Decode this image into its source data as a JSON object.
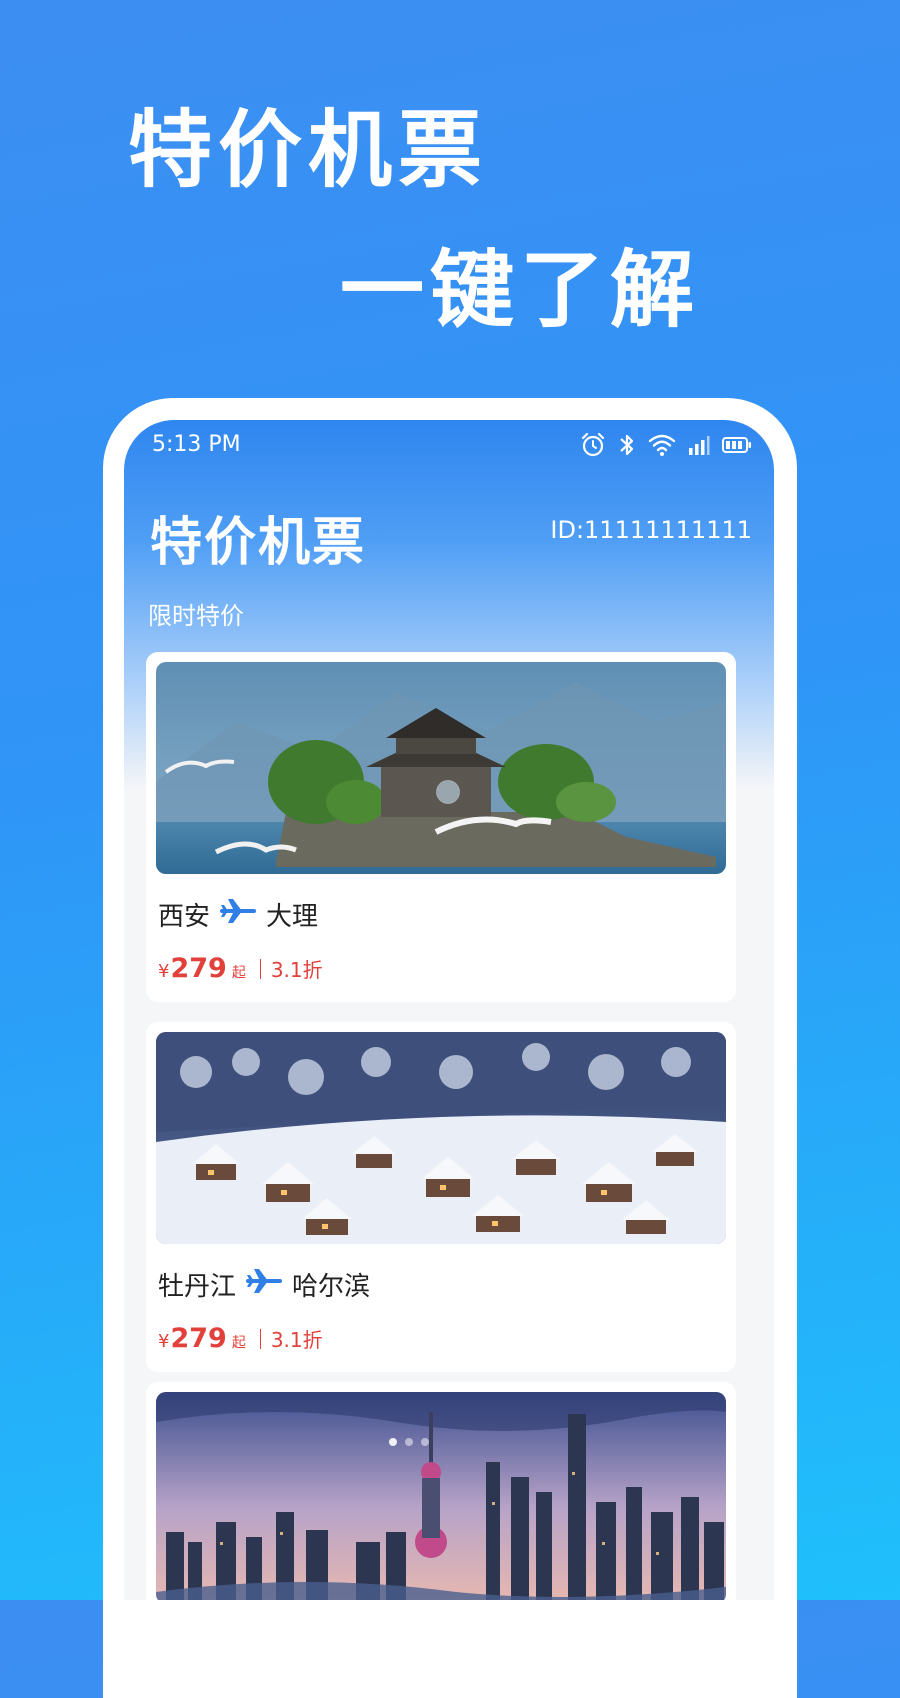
{
  "promo": {
    "line1": "特价机票",
    "line2": "一键了解"
  },
  "status_bar": {
    "time": "5:13 PM",
    "icons": [
      "alarm-icon",
      "bluetooth-icon",
      "wifi-icon",
      "signal-icon",
      "battery-icon"
    ]
  },
  "header": {
    "title": "特价机票",
    "user_id": "ID:11111111111",
    "section_label": "限时特价"
  },
  "deals": [
    {
      "from": "西安",
      "to": "大理",
      "currency": "¥",
      "price": "279",
      "price_suffix": "起",
      "discount": "3.1折",
      "image": "lake-pavilion-island"
    },
    {
      "from": "牡丹江",
      "to": "哈尔滨",
      "currency": "¥",
      "price": "279",
      "price_suffix": "起",
      "discount": "3.1折",
      "image": "snowy-village-night"
    },
    {
      "image": "city-skyline-dusk"
    }
  ],
  "colors": {
    "primary_blue": "#2f86ef",
    "price_red": "#e2403a",
    "plane_blue": "#2f7fe6"
  }
}
